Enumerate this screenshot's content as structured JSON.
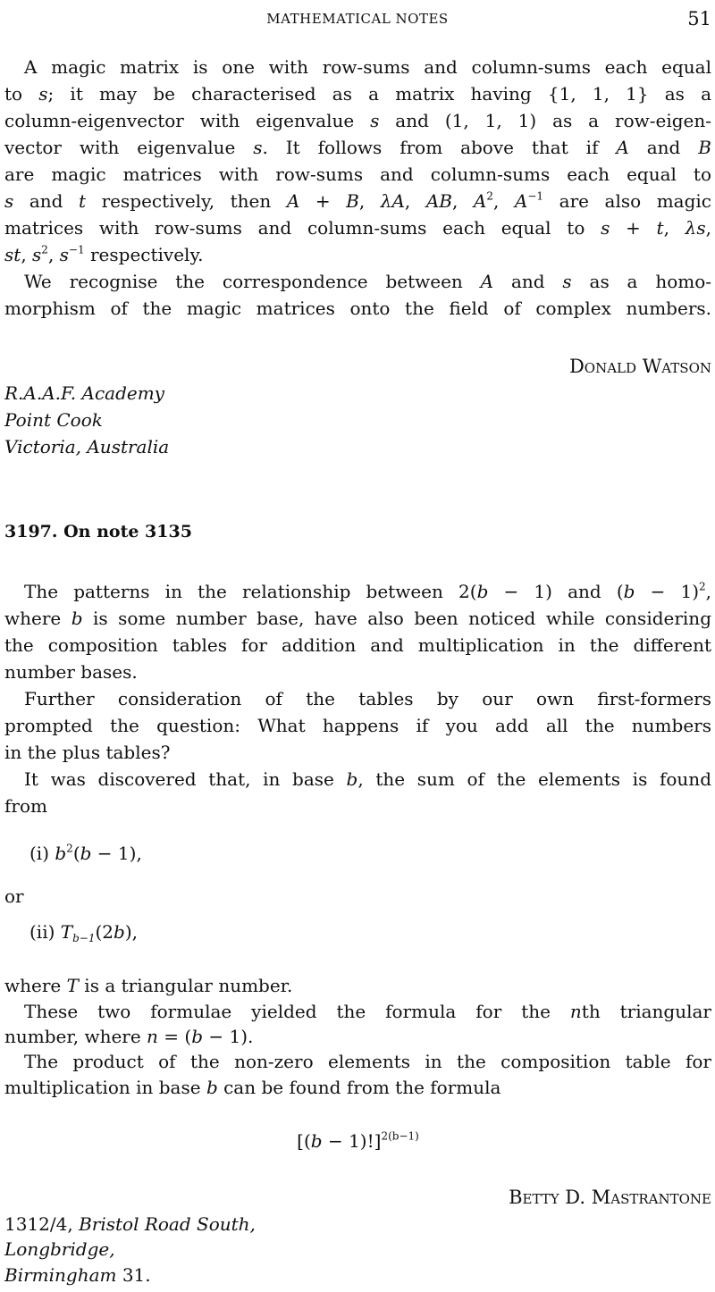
{
  "header": {
    "running_title": "MATHEMATICAL NOTES",
    "page_number": "51"
  },
  "lines": [
    {
      "runs": [
        {
          "t": "A magic matrix is one with row-sums and column-sums each equal",
          "s": ""
        }
      ]
    },
    {
      "runs": [
        {
          "t": "to ",
          "s": ""
        },
        {
          "t": "s",
          "s": "i"
        },
        {
          "t": ";  it may be characterised as a matrix having {1, 1, 1} as a",
          "s": ""
        }
      ]
    },
    {
      "runs": [
        {
          "t": "column-eigenvector with eigenvalue ",
          "s": ""
        },
        {
          "t": "s",
          "s": "i"
        },
        {
          "t": " and (1, 1, 1) as a row-eigen-",
          "s": ""
        }
      ]
    },
    {
      "runs": [
        {
          "t": "vector with eigenvalue ",
          "s": ""
        },
        {
          "t": "s",
          "s": "i"
        },
        {
          "t": ".  It follows from above that if ",
          "s": ""
        },
        {
          "t": "A",
          "s": "i"
        },
        {
          "t": " and ",
          "s": ""
        },
        {
          "t": "B",
          "s": "i"
        }
      ]
    },
    {
      "runs": [
        {
          "t": "are magic matrices with row-sums and column-sums each equal to",
          "s": ""
        }
      ]
    },
    {
      "runs": [
        {
          "t": "s",
          "s": "i"
        },
        {
          "t": " and ",
          "s": ""
        },
        {
          "t": "t",
          "s": "i"
        },
        {
          "t": " respectively, then ",
          "s": ""
        },
        {
          "t": "A",
          "s": "i"
        },
        {
          "t": " + ",
          "s": ""
        },
        {
          "t": "B",
          "s": "i"
        },
        {
          "t": ", ",
          "s": ""
        },
        {
          "t": "λA",
          "s": "i"
        },
        {
          "t": ", ",
          "s": ""
        },
        {
          "t": "AB",
          "s": "i"
        },
        {
          "t": ", ",
          "s": ""
        },
        {
          "t": "A",
          "s": "i"
        },
        {
          "t": "2",
          "s": "sup"
        },
        {
          "t": ", ",
          "s": ""
        },
        {
          "t": "A",
          "s": "i"
        },
        {
          "t": "−1",
          "s": "sup"
        },
        {
          "t": " are also magic",
          "s": ""
        }
      ]
    },
    {
      "runs": [
        {
          "t": "matrices with row-sums and column-sums each equal to ",
          "s": ""
        },
        {
          "t": "s",
          "s": "i"
        },
        {
          "t": " + ",
          "s": ""
        },
        {
          "t": "t",
          "s": "i"
        },
        {
          "t": ", ",
          "s": ""
        },
        {
          "t": "λs",
          "s": "i"
        },
        {
          "t": ",",
          "s": ""
        }
      ]
    },
    {
      "runs": [
        {
          "t": "st",
          "s": "i"
        },
        {
          "t": ", ",
          "s": ""
        },
        {
          "t": "s",
          "s": "i"
        },
        {
          "t": "2",
          "s": "sup"
        },
        {
          "t": ", ",
          "s": ""
        },
        {
          "t": "s",
          "s": "i"
        },
        {
          "t": "−1",
          "s": "sup"
        },
        {
          "t": " respectively.",
          "s": ""
        }
      ]
    },
    {
      "runs": [
        {
          "t": "We recognise the correspondence between ",
          "s": ""
        },
        {
          "t": "A",
          "s": "i"
        },
        {
          "t": " and ",
          "s": ""
        },
        {
          "t": "s",
          "s": "i"
        },
        {
          "t": " as a homo-",
          "s": ""
        }
      ]
    },
    {
      "runs": [
        {
          "t": "morphism of the magic matrices onto the field of complex numbers.",
          "s": ""
        }
      ]
    },
    {
      "runs": [
        {
          "t": "The patterns in the relationship between 2(",
          "s": ""
        },
        {
          "t": "b",
          "s": "i"
        },
        {
          "t": " − 1) and (",
          "s": ""
        },
        {
          "t": "b",
          "s": "i"
        },
        {
          "t": " − 1)",
          "s": ""
        },
        {
          "t": "2",
          "s": "sup"
        },
        {
          "t": ",",
          "s": ""
        }
      ]
    },
    {
      "runs": [
        {
          "t": "where ",
          "s": ""
        },
        {
          "t": "b",
          "s": "i"
        },
        {
          "t": " is some number base, have also been noticed while considering",
          "s": ""
        }
      ]
    },
    {
      "runs": [
        {
          "t": "the composition tables for addition and multiplication in the different",
          "s": ""
        }
      ]
    },
    {
      "runs": [
        {
          "t": "number bases.",
          "s": ""
        }
      ]
    },
    {
      "runs": [
        {
          "t": "Further consideration of the tables by our own first-formers",
          "s": ""
        }
      ]
    },
    {
      "runs": [
        {
          "t": "prompted the question:  What happens if you add all the numbers",
          "s": ""
        }
      ]
    },
    {
      "runs": [
        {
          "t": "in the plus tables?",
          "s": ""
        }
      ]
    },
    {
      "runs": [
        {
          "t": "It was discovered that, in base ",
          "s": ""
        },
        {
          "t": "b",
          "s": "i"
        },
        {
          "t": ", the sum of the elements is found",
          "s": ""
        }
      ]
    },
    {
      "runs": [
        {
          "t": "from",
          "s": ""
        }
      ]
    },
    {
      "runs": [
        {
          "t": "(i) ",
          "s": ""
        },
        {
          "t": "b",
          "s": "i"
        },
        {
          "t": "2",
          "s": "sup"
        },
        {
          "t": "(",
          "s": ""
        },
        {
          "t": "b",
          "s": "i"
        },
        {
          "t": " − 1),",
          "s": ""
        }
      ]
    },
    {
      "runs": [
        {
          "t": "or",
          "s": ""
        }
      ]
    },
    {
      "runs": [
        {
          "t": "(ii) ",
          "s": ""
        },
        {
          "t": "T",
          "s": "i"
        },
        {
          "t": "b−1",
          "s": "sub"
        },
        {
          "t": "(2",
          "s": ""
        },
        {
          "t": "b",
          "s": "i"
        },
        {
          "t": "),",
          "s": ""
        }
      ]
    },
    {
      "runs": [
        {
          "t": "where ",
          "s": ""
        },
        {
          "t": "T",
          "s": "i"
        },
        {
          "t": " is a triangular number.",
          "s": ""
        }
      ]
    },
    {
      "runs": [
        {
          "t": "These two formulae yielded the formula for the ",
          "s": ""
        },
        {
          "t": "n",
          "s": "i"
        },
        {
          "t": "th triangular",
          "s": ""
        }
      ]
    },
    {
      "runs": [
        {
          "t": "number, where ",
          "s": ""
        },
        {
          "t": "n",
          "s": "i"
        },
        {
          "t": " = (",
          "s": ""
        },
        {
          "t": "b",
          "s": "i"
        },
        {
          "t": " − 1).",
          "s": ""
        }
      ]
    },
    {
      "runs": [
        {
          "t": "The product of the non-zero elements in the composition table for",
          "s": ""
        }
      ]
    },
    {
      "runs": [
        {
          "t": "multiplication in base ",
          "s": ""
        },
        {
          "t": "b",
          "s": "i"
        },
        {
          "t": " can be found from the formula",
          "s": ""
        }
      ]
    },
    {
      "runs": [
        {
          "t": "[(",
          "s": ""
        },
        {
          "t": "b",
          "s": "i"
        },
        {
          "t": " − 1)!]",
          "s": ""
        },
        {
          "t": "2(b−1)",
          "s": "sup"
        }
      ]
    }
  ],
  "note1": {
    "author": "Donald Watson",
    "address": [
      "R.A.A.F. Academy",
      "Point Cook",
      "Victoria, Australia"
    ]
  },
  "note2": {
    "heading": "3197. On note 3135",
    "author": "Betty D. Mastrantone",
    "address_number": "1312/4, ",
    "address_street": "Bristol Road South,",
    "address_town": "Longbridge,",
    "address_city": "Birmingham",
    "address_postcode": " 31."
  }
}
